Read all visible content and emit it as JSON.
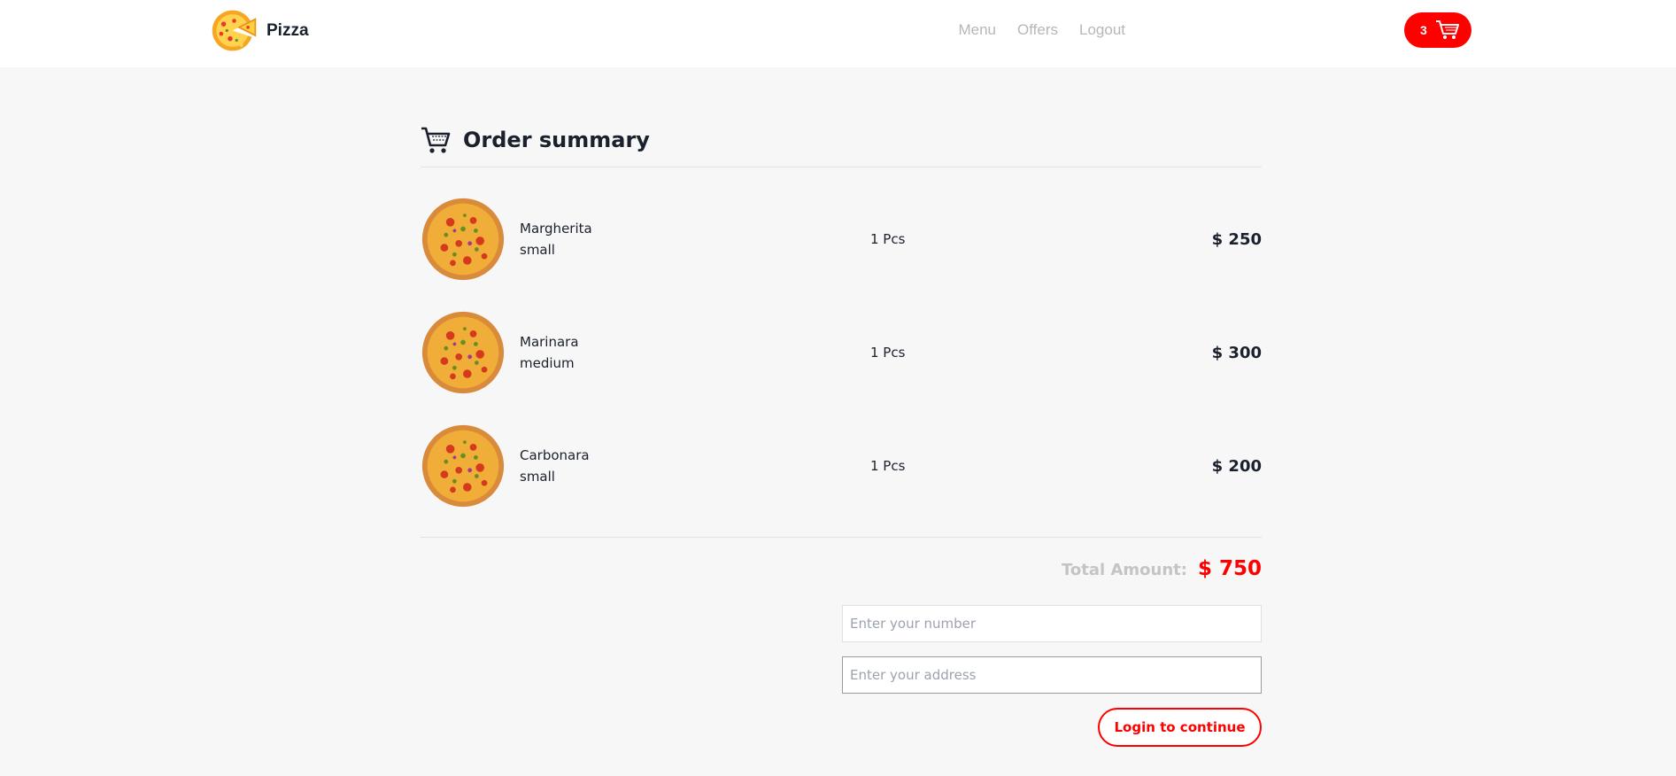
{
  "navbar": {
    "brand_name": "Pizza",
    "links": [
      "Menu",
      "Offers",
      "Logout"
    ],
    "cart_count": "3"
  },
  "summary": {
    "title": "Order summary"
  },
  "items": [
    {
      "name": "Margherita",
      "size": "small",
      "qty": "1 Pcs",
      "price": "$ 250"
    },
    {
      "name": "Marinara",
      "size": "medium",
      "qty": "1 Pcs",
      "price": "$ 300"
    },
    {
      "name": "Carbonara",
      "size": "small",
      "qty": "1 Pcs",
      "price": "$ 200"
    }
  ],
  "total": {
    "label": "Total Amount:",
    "value": "$ 750"
  },
  "form": {
    "number_placeholder": "Enter your number",
    "address_placeholder": "Enter your address",
    "number_value": "",
    "address_value": "",
    "submit_label": "Login to continue"
  },
  "colors": {
    "accent": "#ff0000",
    "background": "#f7f7f7",
    "nav_link": "#b7b7b7"
  },
  "icons": {
    "logo": "pizza-slice-logo-icon",
    "cart": "cart-icon",
    "item_image": "pizza-icon"
  }
}
